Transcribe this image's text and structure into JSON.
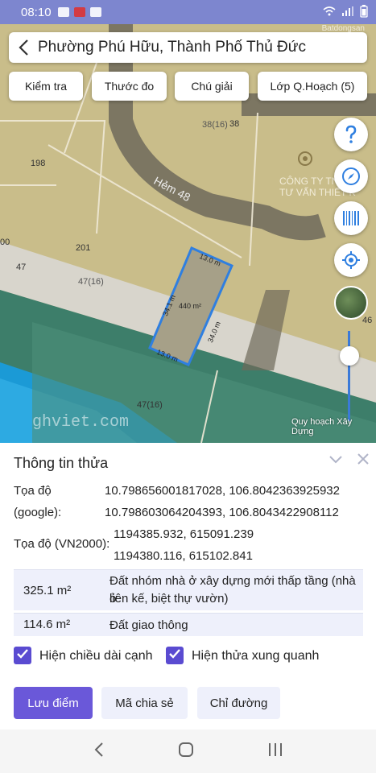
{
  "status_bar": {
    "time": "08:10"
  },
  "watermark": "Batdongsan",
  "search": {
    "title": "Phường Phú Hữu, Thành Phố Thủ Đức"
  },
  "toolbar": {
    "inspect": "Kiểm tra",
    "measure": "Thước đo",
    "legend": "Chú giải",
    "layers": "Lớp Q.Hoạch (5)"
  },
  "map": {
    "street_name": "Hẻm 48",
    "company_line1": "CÔNG TY TNHH",
    "company_line2": "TƯ VẤN THIẾT K",
    "parcel_labels": [
      "38(16)",
      "38",
      "198",
      "201",
      "47",
      "47(16)",
      "47(16)",
      "00",
      "46"
    ],
    "plot_area": "440 m²",
    "edge_top": "13.0 m",
    "edge_left": "34.1 m",
    "edge_right": "34.0 m",
    "edge_bottom": "13.0 m",
    "watermark_text": "ghviet.com",
    "caption": "Quy hoạch Xây Dựng"
  },
  "panel": {
    "title": "Thông tin thửa",
    "coord_label_1": "Tọa độ",
    "coord_label_2": "(google):",
    "coord_google_1": "10.798656001817028, 106.8042363925932",
    "coord_google_2": "10.798603064204393, 106.8043422908112",
    "vn2000_label": "Tọa độ (VN2000):",
    "coord_vn2000_1": "1194385.932, 615091.239",
    "coord_vn2000_2": "1194380.116, 615102.841",
    "land_uses": [
      {
        "area": "325.1 m²",
        "desc_line1": "Đất nhóm nhà ở xây dựng mới thấp tầng (nhà ở",
        "desc_line2": "liên kế, biệt thự vườn)"
      },
      {
        "area": "114.6 m²",
        "desc_line1": "Đất giao thông"
      }
    ],
    "checkbox_edges": "Hiện chiều dài cạnh",
    "checkbox_neighbors": "Hiện thửa xung quanh",
    "save_point": "Lưu điểm",
    "share_code": "Mã chia sẻ",
    "directions": "Chỉ đường"
  },
  "colors": {
    "accent": "#6a58d9",
    "status_bar": "#7d86cf",
    "parcel_outline": "#2f7fe0",
    "map_land": "#c9bd8a",
    "map_road": "#6f6a5a",
    "map_water": "#1b9ad6"
  }
}
